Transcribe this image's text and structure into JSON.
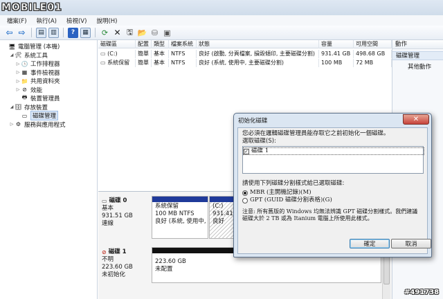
{
  "watermark": {
    "text": "MOBILE01",
    "badge": "#491738"
  },
  "menu": [
    "檔案(F)",
    "執行(A)",
    "檢視(V)",
    "說明(H)"
  ],
  "tree": [
    {
      "label": "電腦管理 (本機)",
      "indent": 0,
      "expander": "",
      "icon": "computer-icon",
      "glyph": "🖥"
    },
    {
      "label": "系統工具",
      "indent": 1,
      "expander": "◢",
      "icon": "tools-icon",
      "glyph": "🛠"
    },
    {
      "label": "工作排程器",
      "indent": 2,
      "expander": "▷",
      "icon": "clock-icon",
      "glyph": "🕒"
    },
    {
      "label": "事件檢視器",
      "indent": 2,
      "expander": "▷",
      "icon": "event-viewer-icon",
      "glyph": "▦"
    },
    {
      "label": "共用資料夾",
      "indent": 2,
      "expander": "▷",
      "icon": "shared-folder-icon",
      "glyph": "📁"
    },
    {
      "label": "效能",
      "indent": 2,
      "expander": "▷",
      "icon": "performance-icon",
      "glyph": "⊘"
    },
    {
      "label": "裝置管理員",
      "indent": 2,
      "expander": "",
      "icon": "device-manager-icon",
      "glyph": "🖶"
    },
    {
      "label": "存放裝置",
      "indent": 1,
      "expander": "◢",
      "icon": "storage-icon",
      "glyph": "🗄"
    },
    {
      "label": "磁碟管理",
      "indent": 2,
      "expander": "",
      "icon": "disk-management-icon",
      "glyph": "▭",
      "selected": true
    },
    {
      "label": "服務與應用程式",
      "indent": 1,
      "expander": "▷",
      "icon": "services-icon",
      "glyph": "⚙"
    }
  ],
  "volumes": {
    "headers": [
      "磁碟區",
      "配置",
      "類型",
      "檔案系統",
      "狀態",
      "容量",
      "可用空間"
    ],
    "rows": [
      [
        "(C:)",
        "簡單",
        "基本",
        "NTFS",
        "良好 (啟動, 分頁檔案, 損毀傾印, 主要磁碟分割)",
        "931.41 GB",
        "498.68 GB"
      ],
      [
        "系統保留",
        "簡單",
        "基本",
        "NTFS",
        "良好 (系統, 使用中, 主要磁碟分割)",
        "100 MB",
        "72 MB"
      ]
    ]
  },
  "actions": {
    "header": "動作",
    "group": "磁碟管理",
    "item": "其他動作"
  },
  "disks": [
    {
      "name": "磁碟 0",
      "type": "基本",
      "size": "931.51 GB",
      "status": "連線"
    },
    {
      "name": "磁碟 1",
      "type": "不明",
      "size": "223.60 GB",
      "status": "未初始化"
    }
  ],
  "partitions": [
    {
      "name": "系統保留",
      "size": "100 MB NTFS",
      "status": "良好 (系統, 使用中,"
    },
    {
      "name": "(C:)",
      "size": "931.41",
      "status": "良好"
    },
    {
      "name": "",
      "size": "223.60 GB",
      "status": "未配置"
    }
  ],
  "dialog": {
    "title": "初始化磁碟",
    "close": "✕",
    "intro": "您必須在邏輯磁碟管理員能存取它之前初始化一個磁碟。",
    "select_label": "選取磁碟(S):",
    "disk_item": "磁碟 1",
    "style_label": "請使用下列磁碟分割樣式給已選取磁碟:",
    "option_mbr": "MBR (主開機記錄)(M)",
    "option_gpt": "GPT (GUID 磁碟分割表格)(G)",
    "note": "注意: 所有舊版的 Windows 均無法辨識 GPT 磁碟分割樣式。我們建議磁碟大於 2 TB 或為 Itanium 電腦上所使用此樣式。",
    "ok": "確定",
    "cancel": "取消"
  }
}
